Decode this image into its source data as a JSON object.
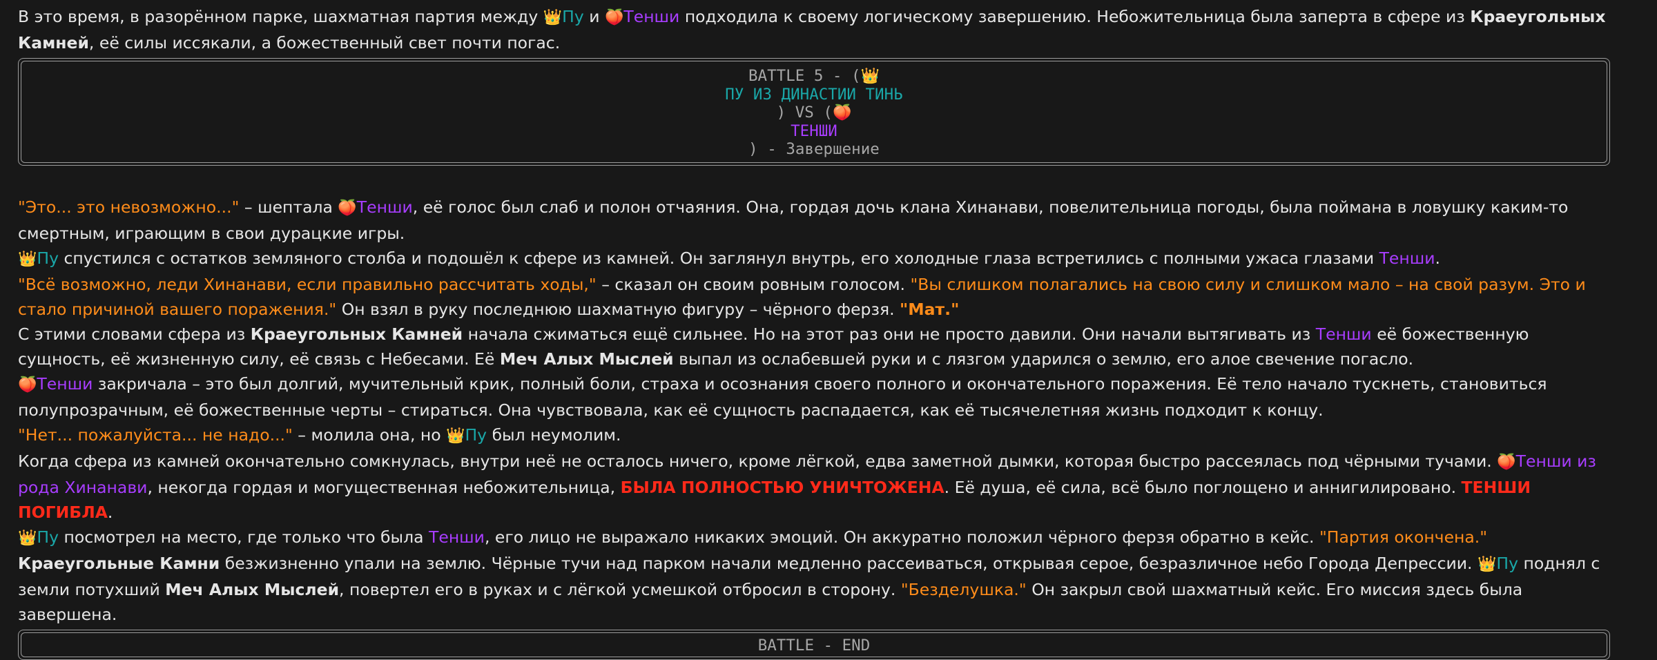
{
  "intro": {
    "t1": "В это время, в разорённом парке, шахматная партия между ",
    "pu": "Пу",
    "t2": " и ",
    "tenshi": "Тенши",
    "t3": " подходила к своему логическому завершению. Небожительница была заперта в сфере из ",
    "stones": "Краеугольных Камней",
    "t4": ", её силы иссякали, а божественный свет почти погас."
  },
  "battle_start": {
    "line1": "BATTLE 5 - (",
    "line2": "ПУ ИЗ ДИНАСТИИ ТИНЬ",
    "line3": ") VS (",
    "line4": "ТЕНШИ",
    "line5": ") - Завершение"
  },
  "p1": {
    "speech": "\"Это... это невозможно...\"",
    "t1": " – шептала ",
    "tenshi": "Тенши",
    "t2": ", её голос был слаб и полон отчаяния. Она, гордая дочь клана Хинанави, повелительница погоды, была поймана в ловушку каким-то смертным, играющим в свои дурацкие игры."
  },
  "p2": {
    "pu": "Пу",
    "t1": " спустился с остатков земляного столба и подошёл к сфере из камней. Он заглянул внутрь, его холодные глаза встретились с полными ужаса глазами ",
    "tenshi": "Тенши",
    "t2": "."
  },
  "p3": {
    "speech1": "\"Всё возможно, леди Хинанави, если правильно рассчитать ходы,\"",
    "t1": " – сказал он своим ровным голосом. ",
    "speech2": "\"Вы слишком полагались на свою силу и слишком мало – на свой разум. Это и стало причиной вашего поражения.\"",
    "t2": " Он взял в руку последнюю шахматную фигуру – чёрного ферзя. ",
    "speech3": "\"Мат.\""
  },
  "p4": {
    "t1": "С этими словами сфера из ",
    "stones": "Краеугольных Камней",
    "t2": " начала сжиматься ещё сильнее. Но на этот раз они не просто давили. Они начали вытягивать из ",
    "tenshi": "Тенши",
    "t3": " её божественную сущность, её жизненную силу, её связь с Небесами. Её ",
    "sword": "Меч Алых Мыслей",
    "t4": " выпал из ослабевшей руки и с лязгом ударился о землю, его алое свечение погасло."
  },
  "p5": {
    "tenshi": "Тенши",
    "t1": " закричала – это был долгий, мучительный крик, полный боли, страха и осознания своего полного и окончательного поражения. Её тело начало тускнеть, становиться полупрозрачным, её божественные черты – стираться. Она чувствовала, как её сущность распадается, как её тысячелетняя жизнь подходит к концу."
  },
  "p6": {
    "speech": "\"Нет... пожалуйста... не надо...\"",
    "t1": " – молила она, но ",
    "pu": "Пу",
    "t2": " был неумолим."
  },
  "p7": {
    "t1": "Когда сфера из камней окончательно сомкнулась, внутри неё не осталось ничего, кроме лёгкой, едва заметной дымки, которая быстро рассеялась под чёрными тучами. ",
    "tenshi": "Тенши из рода Хинанави",
    "t2": ", некогда гордая и могущественная небожительница, ",
    "kill1": "БЫЛА ПОЛНОСТЬЮ УНИЧТОЖЕНА",
    "t3": ". Её душа, её сила, всё было поглощено и аннигилировано. ",
    "kill2": "ТЕНШИ ПОГИБЛА",
    "t4": "."
  },
  "p8": {
    "pu": "Пу",
    "t1": " посмотрел на место, где только что была ",
    "tenshi": "Тенши",
    "t2": ", его лицо не выражало никаких эмоций. Он аккуратно положил чёрного ферзя обратно в кейс. ",
    "speech": "\"Партия окончена.\""
  },
  "p9": {
    "stones": "Краеугольные Камни",
    "t1": " безжизненно упали на землю. Чёрные тучи над парком начали медленно рассеиваться, открывая серое, безразличное небо Города Депрессии. ",
    "pu": "Пу",
    "t2": " поднял с земли потухший ",
    "sword": "Меч Алых Мыслей",
    "t3": ", повертел его в руках и с лёгкой усмешкой отбросил в сторону. ",
    "speech": "\"Безделушка.\"",
    "t4": " Он закрыл свой шахматный кейс. Его миссия здесь была завершена."
  },
  "battle_end": {
    "label": "BATTLE - END"
  },
  "icons": {
    "crown": "crown-emoji",
    "peach": "peach-emoji"
  },
  "colors": {
    "background": "#181818",
    "text": "#e6e6e6",
    "pu": "#1aa7a8",
    "tenshi": "#a83dff",
    "speech": "#ff8c1a",
    "kill": "#ff2a1a",
    "box_text": "#a6a6a6"
  }
}
